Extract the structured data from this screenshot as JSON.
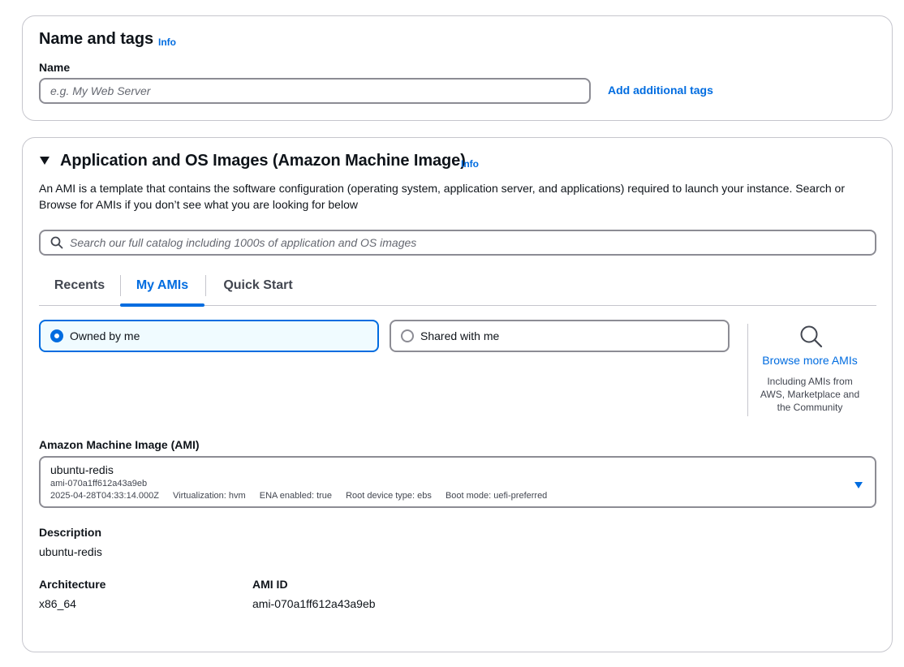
{
  "name_tags": {
    "title": "Name and tags",
    "info": "Info",
    "name_label": "Name",
    "name_placeholder": "e.g. My Web Server",
    "add_tags_link": "Add additional tags"
  },
  "ami_section": {
    "title": "Application and OS Images (Amazon Machine Image)",
    "info": "Info",
    "description_line1": "An AMI is a template that contains the software configuration (operating system, application server, and applications) required to launch your instance. Search or",
    "description_line2": "Browse for AMIs if you don’t see what you are looking for below",
    "search_placeholder": "Search our full catalog including 1000s of application and OS images",
    "tabs": [
      {
        "label": "Recents",
        "active": false
      },
      {
        "label": "My AMIs",
        "active": true
      },
      {
        "label": "Quick Start",
        "active": false
      }
    ],
    "owner_options": [
      {
        "label": "Owned by me",
        "selected": true
      },
      {
        "label": "Shared with me",
        "selected": false
      }
    ],
    "browse": {
      "link": "Browse more AMIs",
      "desc_line1": "Including AMIs from",
      "desc_line2": "AWS, Marketplace and",
      "desc_line3": "the Community"
    },
    "ami_label": "Amazon Machine Image (AMI)",
    "selected_ami": {
      "name": "ubuntu-redis",
      "id": "ami-070a1ff612a43a9eb",
      "created": "2025-04-28T04:33:14.000Z",
      "virtualization": "Virtualization: hvm",
      "ena": "ENA enabled: true",
      "root_device": "Root device type: ebs",
      "boot_mode": "Boot mode: uefi-preferred"
    },
    "details": {
      "description_label": "Description",
      "description_value": "ubuntu-redis",
      "architecture_label": "Architecture",
      "architecture_value": "x86_64",
      "ami_id_label": "AMI ID",
      "ami_id_value": "ami-070a1ff612a43a9eb"
    }
  },
  "colors": {
    "accent": "#006ce0",
    "border": "#8c8c94",
    "selected_bg": "#f0fbff"
  }
}
